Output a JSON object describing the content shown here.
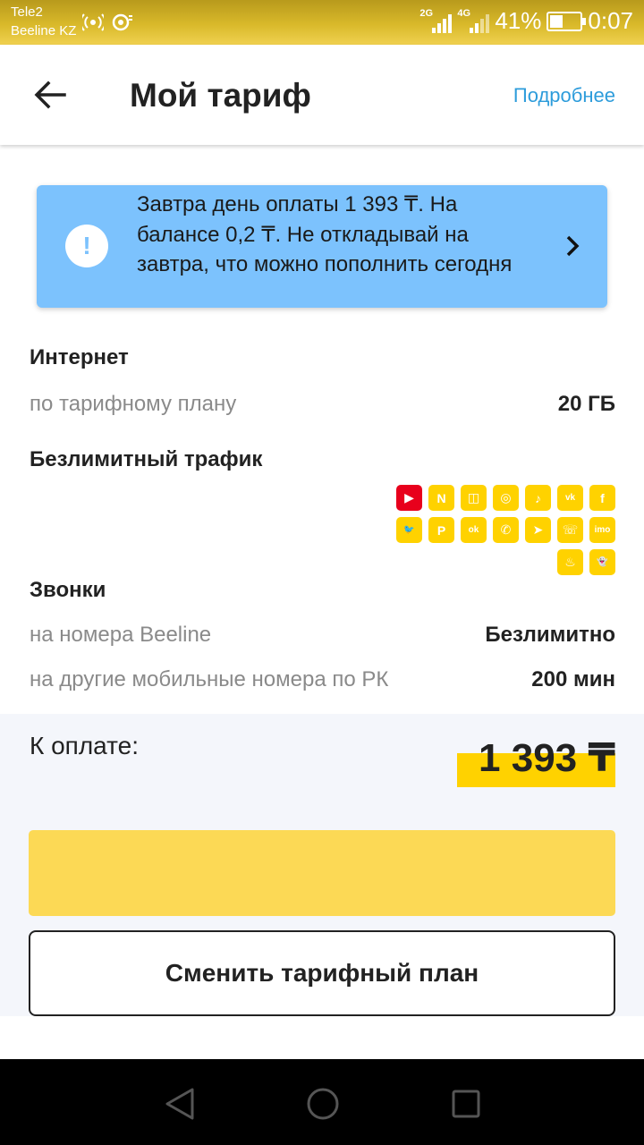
{
  "status_bar": {
    "carrier_1": "Tele2",
    "carrier_2": "Beeline KZ",
    "net_1": "2G",
    "net_2": "4G",
    "battery": "41%",
    "battery_level": 0.41,
    "time": "0:07"
  },
  "header": {
    "title": "Мой тариф",
    "more_link": "Подробнее",
    "back_icon": "arrow-left-icon"
  },
  "alert": {
    "icon": "exclamation-icon",
    "text": "Завтра день оплаты 1 393 ₸. На балансе 0,2 ₸. Не откладывай на завтра, что можно пополнить сегодня",
    "chevron_icon": "chevron-right-icon",
    "color": "#7cc2fd"
  },
  "internet": {
    "title": "Интернет",
    "row_label": "по тарифному плану",
    "row_value": "20 ГБ"
  },
  "unlimited": {
    "title": "Безлимитный трафик",
    "apps": [
      {
        "name": "youtube-icon",
        "glyph": "▶",
        "color": "#e8001c"
      },
      {
        "name": "news-icon",
        "glyph": "N",
        "color": "#ffd200"
      },
      {
        "name": "twitch-icon",
        "glyph": "◫",
        "color": "#ffd200"
      },
      {
        "name": "instagram-icon",
        "glyph": "◎",
        "color": "#ffd200"
      },
      {
        "name": "tiktok-icon",
        "glyph": "♪",
        "color": "#ffd200"
      },
      {
        "name": "vk-icon",
        "glyph": "vk",
        "color": "#ffd200"
      },
      {
        "name": "facebook-icon",
        "glyph": "f",
        "color": "#ffd200"
      },
      {
        "name": "twitter-icon",
        "glyph": "🐦",
        "color": "#ffd200"
      },
      {
        "name": "pinterest-icon",
        "glyph": "P",
        "color": "#ffd200"
      },
      {
        "name": "odnoklassniki-icon",
        "glyph": "ok",
        "color": "#ffd200"
      },
      {
        "name": "whatsapp-icon",
        "glyph": "✆",
        "color": "#ffd200"
      },
      {
        "name": "telegram-icon",
        "glyph": "➤",
        "color": "#ffd200"
      },
      {
        "name": "viber-icon",
        "glyph": "☏",
        "color": "#ffd200"
      },
      {
        "name": "imo-icon",
        "glyph": "imo",
        "color": "#ffd200"
      },
      {
        "name": "tinder-icon",
        "glyph": "♨",
        "color": "#ffd200"
      },
      {
        "name": "snapchat-icon",
        "glyph": "👻",
        "color": "#ffd200"
      }
    ]
  },
  "calls": {
    "title": "Звонки",
    "rows": [
      {
        "label": "на номера Beeline",
        "value": "Безлимитно"
      },
      {
        "label": "на другие мобильные номера по РК",
        "value": "200 мин"
      }
    ]
  },
  "payment": {
    "label": "К оплате:",
    "amount": "1 393 ₸",
    "pay_button_label": "",
    "change_button_label": "Сменить тарифный план",
    "accent": "#ffd200"
  },
  "navbar": {
    "back": "nav-back-icon",
    "home": "nav-home-icon",
    "recents": "nav-recents-icon"
  }
}
